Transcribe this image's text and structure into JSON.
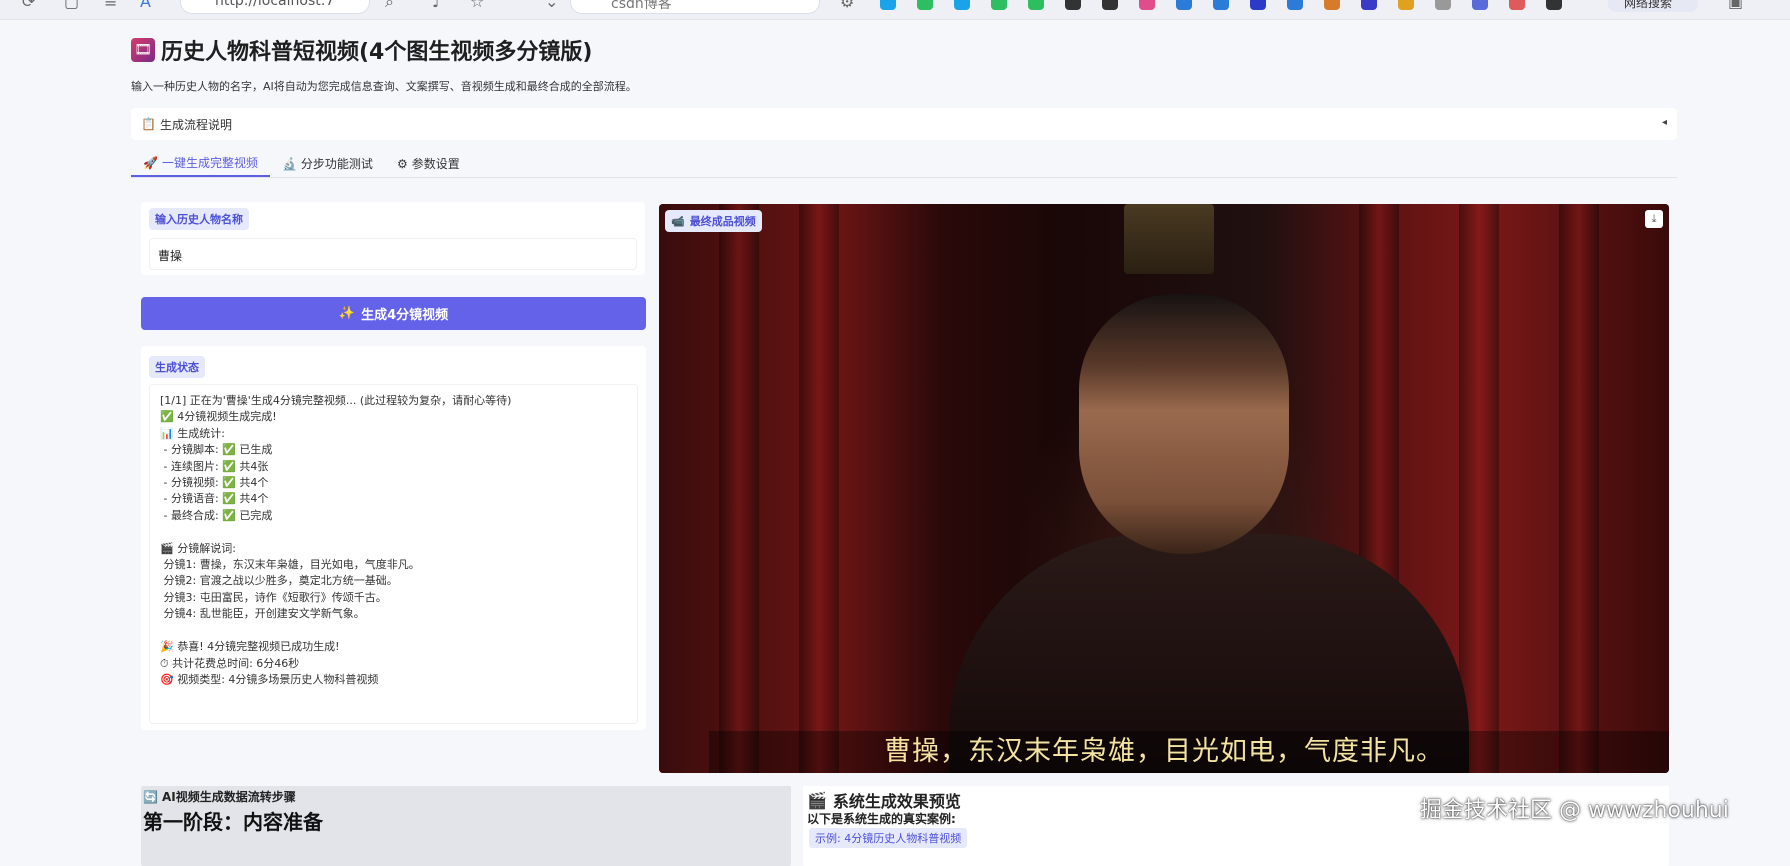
{
  "browser": {
    "address": "http://localhost:7",
    "search": "csdn博客",
    "ext_pill": "网络搜索",
    "colors": [
      "#1aa3e8",
      "#2dbe60",
      "#1aa3e8",
      "#2dbe60",
      "#2dbe60",
      "#333333",
      "#333333",
      "#e04c8c",
      "#2b7bd8",
      "#2b7bd8",
      "#2b3bc8",
      "#2b7bd8",
      "#d77a2a",
      "#3a3ac8",
      "#e0a020",
      "#999999",
      "#5a6ad8",
      "#e05a5a",
      "#333333"
    ]
  },
  "app": {
    "title": "历史人物科普短视频(4个图生视频多分镜版)",
    "title_icon": "🎞",
    "subtitle": "输入一种历史人物的名字，AI将自动为您完成信息查询、文案撰写、音视频生成和最终合成的全部流程。",
    "accordion": {
      "icon": "📋",
      "label": "生成流程说明"
    }
  },
  "tabs": [
    {
      "icon": "🚀",
      "label": "一键生成完整视频",
      "active": true
    },
    {
      "icon": "🔬",
      "label": "分步功能测试",
      "active": false
    },
    {
      "icon": "⚙",
      "label": "参数设置",
      "active": false
    }
  ],
  "form": {
    "name_label": "输入历史人物名称",
    "name_value": "曹操",
    "generate_button": {
      "icon": "✨",
      "label": "生成4分镜视频"
    },
    "status_label": "生成状态",
    "status_text": "[1/1] 正在为'曹操'生成4分镜完整视频... (此过程较为复杂，请耐心等待)\n✅ 4分镜视频生成完成!\n📊 生成统计:\n - 分镜脚本: ✅ 已生成\n - 连续图片: ✅ 共4张\n - 分镜视频: ✅ 共4个\n - 分镜语音: ✅ 共4个\n - 最终合成: ✅ 已完成\n\n🎬 分镜解说词:\n 分镜1: 曹操，东汉末年枭雄，目光如电，气度非凡。\n 分镜2: 官渡之战以少胜多，奠定北方统一基础。\n 分镜3: 屯田富民，诗作《短歌行》传颂千古。\n 分镜4: 乱世能臣，开创建安文学新气象。\n\n🎉 恭喜! 4分镜完整视频已成功生成!\n⏱ 共计花费总时间: 6分46秒\n🎯 视频类型: 4分镜多场景历史人物科普视频"
  },
  "video": {
    "badge_icon": "📹",
    "badge": "最终成品视频",
    "download_icon": "⤓",
    "caption": "曹操，东汉末年枭雄，目光如电，气度非凡。"
  },
  "bottom": {
    "left_icon": "🔄",
    "left_title": "AI视频生成数据流转步骤",
    "left_heading": "第一阶段：内容准备",
    "right_icon": "🎬",
    "right_title": "系统生成效果预览",
    "right_sub": "以下是系统生成的真实案例:",
    "example": "示例: 4分镜历史人物科普视频"
  },
  "watermark": "掘金技术社区 @ wwwzhouhui"
}
